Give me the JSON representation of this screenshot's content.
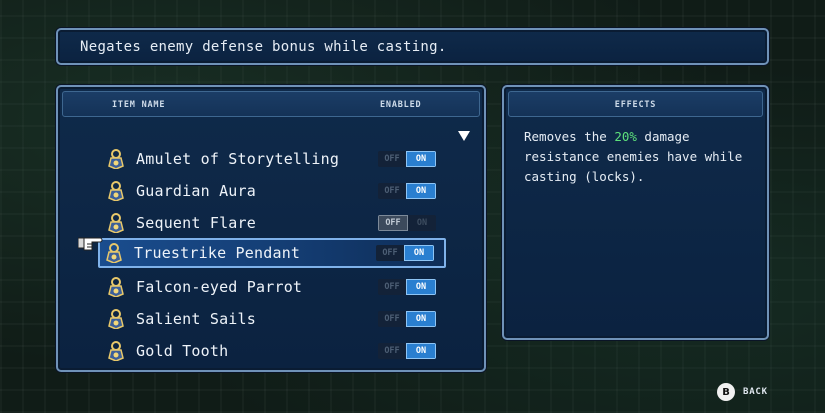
{
  "description": "Negates enemy defense bonus while casting.",
  "list": {
    "header_item_name": "ITEM NAME",
    "header_enabled": "ENABLED",
    "selected_index": 3,
    "items": [
      {
        "name": "Amulet of Storytelling",
        "enabled": true
      },
      {
        "name": "Guardian Aura",
        "enabled": true
      },
      {
        "name": "Sequent Flare",
        "enabled": false
      },
      {
        "name": "Truestrike Pendant",
        "enabled": true
      },
      {
        "name": "Falcon-eyed Parrot",
        "enabled": true
      },
      {
        "name": "Salient Sails",
        "enabled": true
      },
      {
        "name": "Gold Tooth",
        "enabled": true
      }
    ],
    "toggle_off_label": "OFF",
    "toggle_on_label": "ON"
  },
  "effects": {
    "header": "EFFECTS",
    "text_before": "Removes the ",
    "highlight": "20%",
    "text_after": " damage resistance enemies have while casting (locks)."
  },
  "footer": {
    "button_glyph": "B",
    "back_label": "BACK"
  },
  "colors": {
    "panel_bg": "#0f2a4a",
    "panel_border": "#6f92b8",
    "toggle_on": "#2a7fd0",
    "highlight_green": "#5de07b",
    "selected_row": "#1a4d8e"
  },
  "icons": {
    "item_icon": "trinket-icon",
    "cursor": "pointing-hand-icon",
    "scroll": "scroll-down-triangle-icon"
  }
}
